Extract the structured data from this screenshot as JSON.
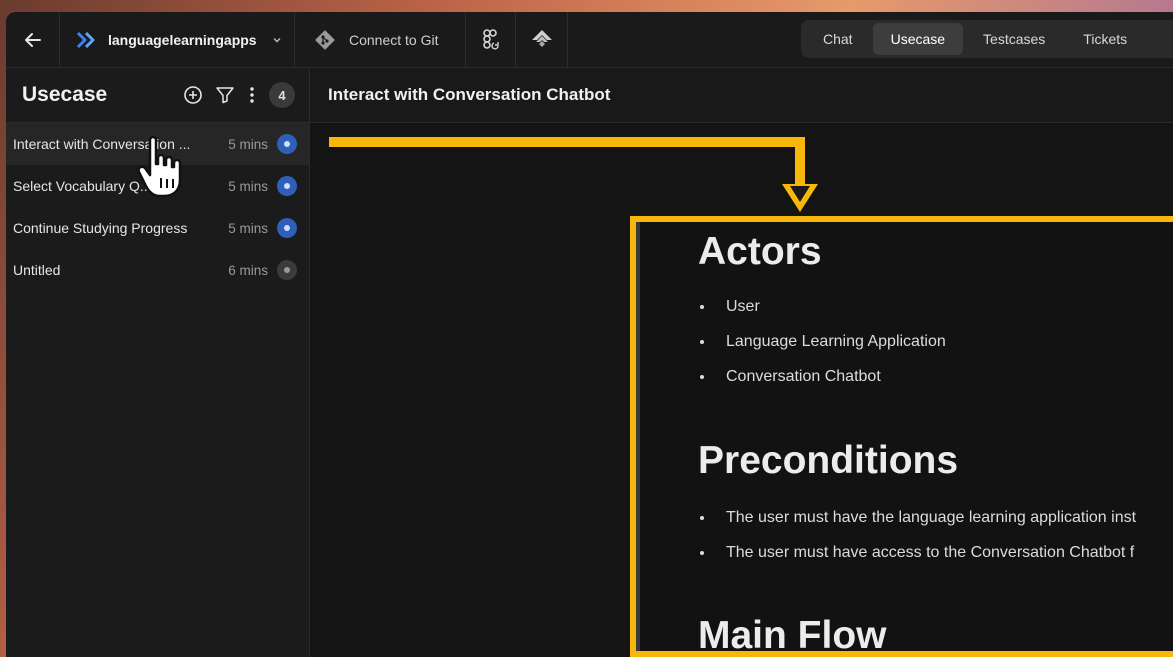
{
  "topbar": {
    "project_name": "languagelearningapps",
    "git_label": "Connect to Git",
    "tabs": [
      {
        "label": "Chat",
        "active": false
      },
      {
        "label": "Usecase",
        "active": true
      },
      {
        "label": "Testcases",
        "active": false
      },
      {
        "label": "Tickets",
        "active": false
      }
    ]
  },
  "sidebar": {
    "title": "Usecase",
    "count": "4",
    "items": [
      {
        "label": "Interact with Conversation ...",
        "time": "5 mins",
        "status": "blue"
      },
      {
        "label": "Select Vocabulary Q...",
        "time": "5 mins",
        "status": "blue"
      },
      {
        "label": "Continue Studying Progress",
        "time": "5 mins",
        "status": "blue"
      },
      {
        "label": "Untitled",
        "time": "6 mins",
        "status": "grey"
      }
    ]
  },
  "main": {
    "title": "Interact with Conversation Chatbot"
  },
  "doc": {
    "actors_heading": "Actors",
    "actors": [
      "User",
      "Language Learning Application",
      "Conversation Chatbot"
    ],
    "preconditions_heading": "Preconditions",
    "preconditions": [
      "The user must have the language learning application inst",
      "The user must have access to the Conversation Chatbot f"
    ],
    "main_flow_heading": "Main Flow"
  },
  "colors": {
    "accent": "#f7b80b",
    "status_blue": "#2f5fb8",
    "background": "#161616"
  }
}
